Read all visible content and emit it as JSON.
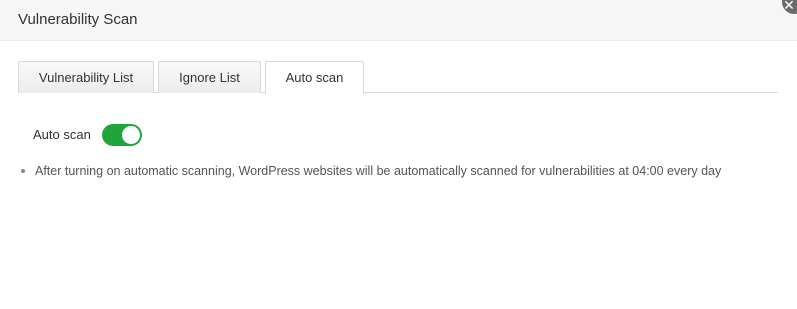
{
  "dialog": {
    "title": "Vulnerability Scan"
  },
  "tabs": [
    {
      "label": "Vulnerability List",
      "active": false
    },
    {
      "label": "Ignore List",
      "active": false
    },
    {
      "label": "Auto scan",
      "active": true
    }
  ],
  "auto_scan": {
    "label": "Auto scan",
    "enabled": true
  },
  "notes": [
    "After turning on automatic scanning, WordPress websites will be automatically scanned for vulnerabilities at 04:00 every day"
  ],
  "colors": {
    "toggle_on": "#20a53a",
    "header_bg": "#f6f6f6"
  },
  "icons": {
    "close": "close-icon"
  }
}
